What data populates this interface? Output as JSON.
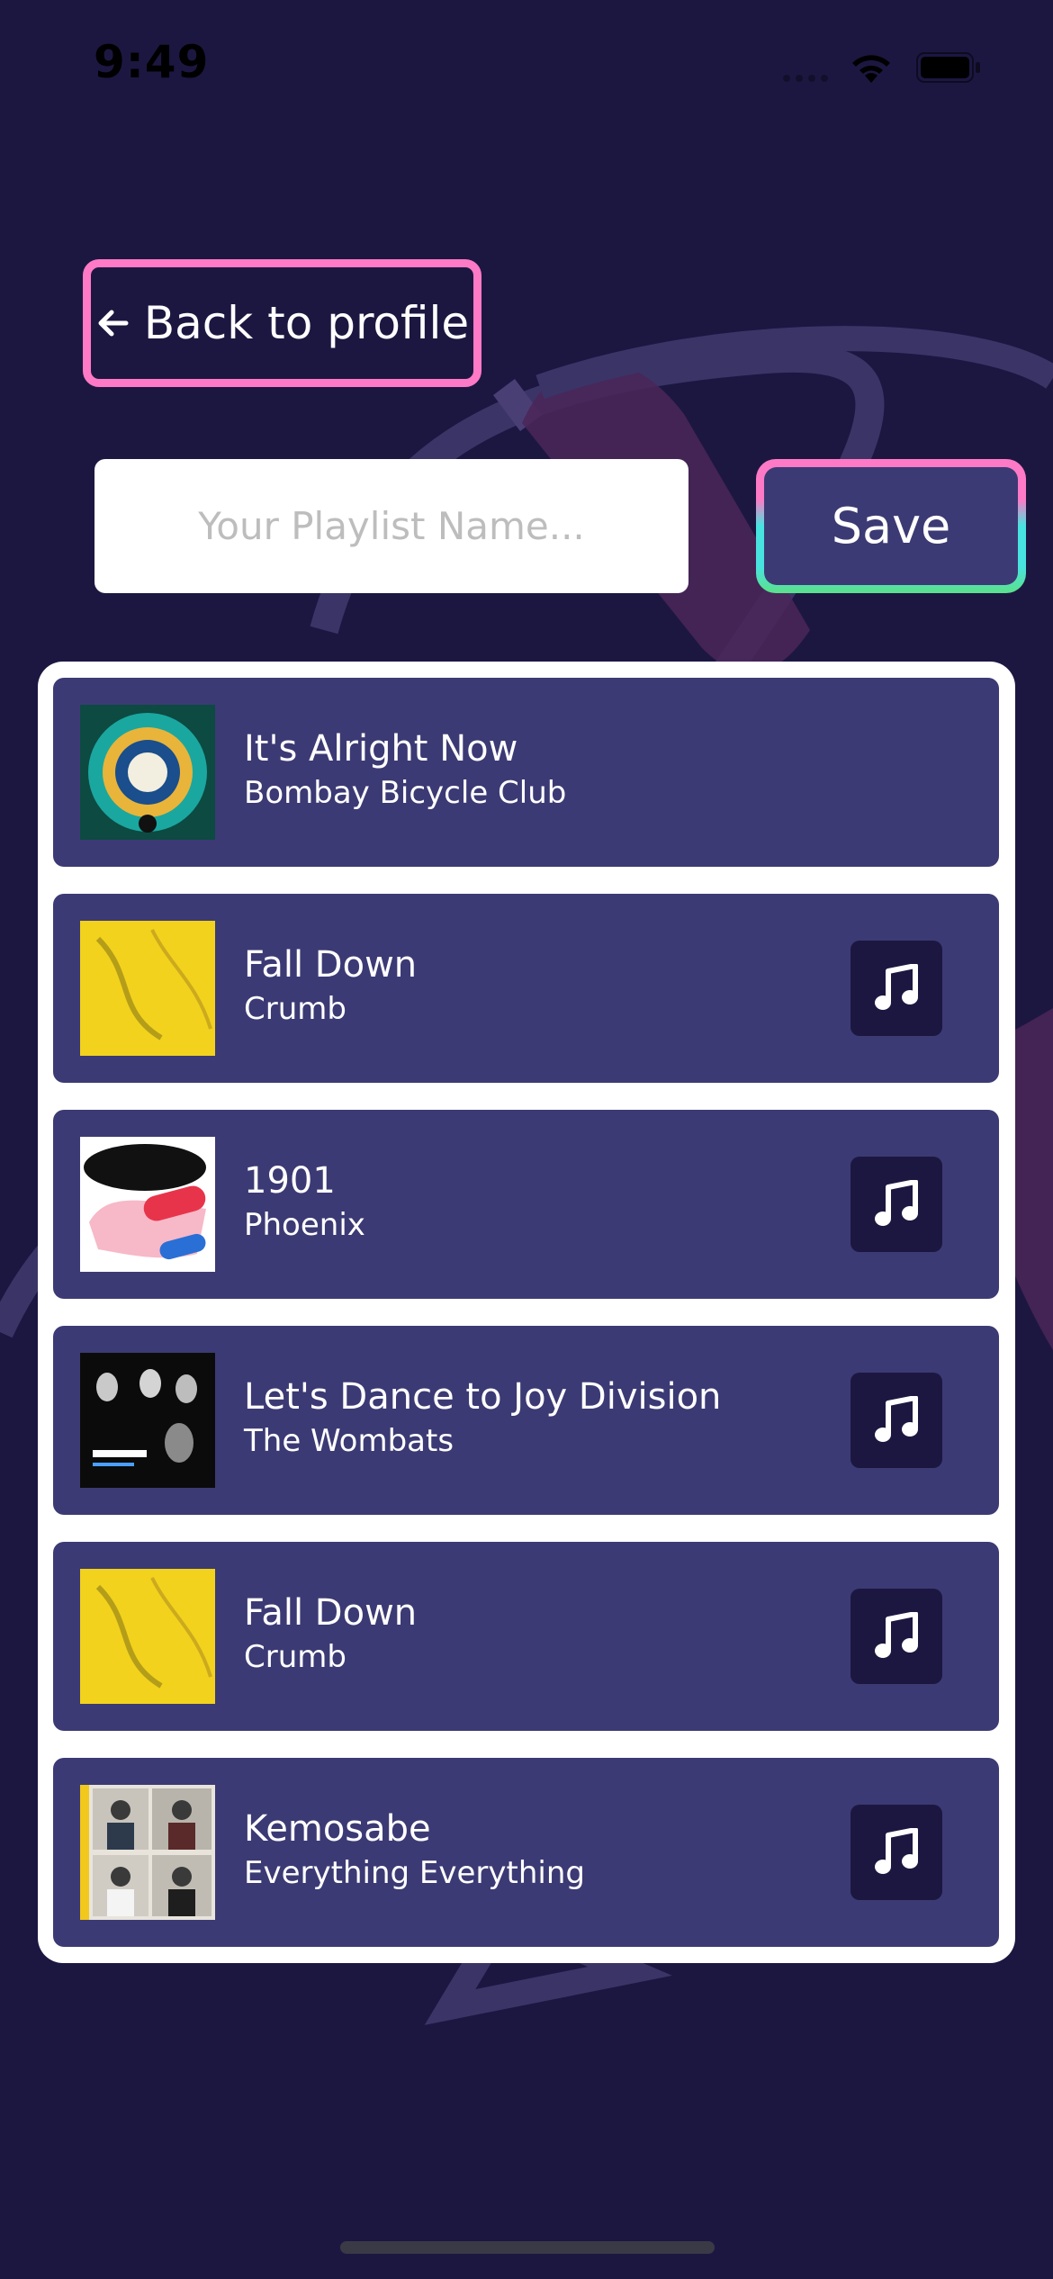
{
  "status_bar": {
    "time": "9:49"
  },
  "back_button": {
    "label": "Back to profile"
  },
  "playlist_name": {
    "placeholder": "Your Playlist Name...",
    "value": ""
  },
  "save_button": {
    "label": "Save"
  },
  "tracks": [
    {
      "title": "It's Alright Now",
      "artist": "Bombay Bicycle Club",
      "has_preview": false
    },
    {
      "title": "Fall Down",
      "artist": "Crumb",
      "has_preview": true
    },
    {
      "title": "1901",
      "artist": "Phoenix",
      "has_preview": true
    },
    {
      "title": "Let's Dance to Joy Division",
      "artist": "The Wombats",
      "has_preview": true
    },
    {
      "title": "Fall Down",
      "artist": "Crumb",
      "has_preview": true
    },
    {
      "title": "Kemosabe",
      "artist": "Everything Everything",
      "has_preview": true
    }
  ],
  "icons": {
    "back": "arrow-left-icon",
    "preview": "music-note-icon",
    "wifi": "wifi-icon",
    "battery": "battery-icon"
  },
  "colors": {
    "background": "#1c1741",
    "card": "#3c3a74",
    "accent_pink": "#ff7ac6",
    "accent_cyan": "#48e3e0",
    "accent_green": "#5be08a"
  }
}
